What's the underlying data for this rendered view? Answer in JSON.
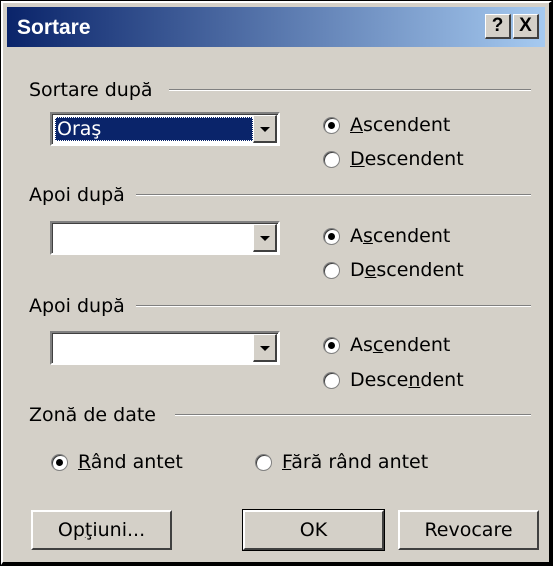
{
  "window": {
    "title": "Sortare",
    "help_label": "?",
    "close_label": "X"
  },
  "groups": [
    {
      "label": "Sortare după",
      "field_value": "Oraş",
      "ascending": {
        "before": "",
        "mnemonic": "A",
        "after": "scendent",
        "checked": true
      },
      "descending": {
        "before": "",
        "mnemonic": "D",
        "after": "escendent",
        "checked": false
      }
    },
    {
      "label": "Apoi după",
      "field_value": "",
      "ascending": {
        "before": "A",
        "mnemonic": "s",
        "after": "cendent",
        "checked": true
      },
      "descending": {
        "before": "D",
        "mnemonic": "e",
        "after": "scendent",
        "checked": false
      }
    },
    {
      "label": "Apoi după",
      "field_value": "",
      "ascending": {
        "before": "As",
        "mnemonic": "c",
        "after": "endent",
        "checked": true
      },
      "descending": {
        "before": "Desce",
        "mnemonic": "n",
        "after": "dent",
        "checked": false
      }
    }
  ],
  "data_range": {
    "label": "Zonă de date",
    "header_row": {
      "before": "",
      "mnemonic": "R",
      "after": "ând antet",
      "checked": true
    },
    "no_header_row": {
      "before": "",
      "mnemonic": "F",
      "after": "ără rând antet",
      "checked": false
    }
  },
  "buttons": {
    "options": {
      "before": "Op",
      "mnemonic": "ţ",
      "after": "iuni..."
    },
    "ok": "OK",
    "cancel": "Revocare"
  }
}
